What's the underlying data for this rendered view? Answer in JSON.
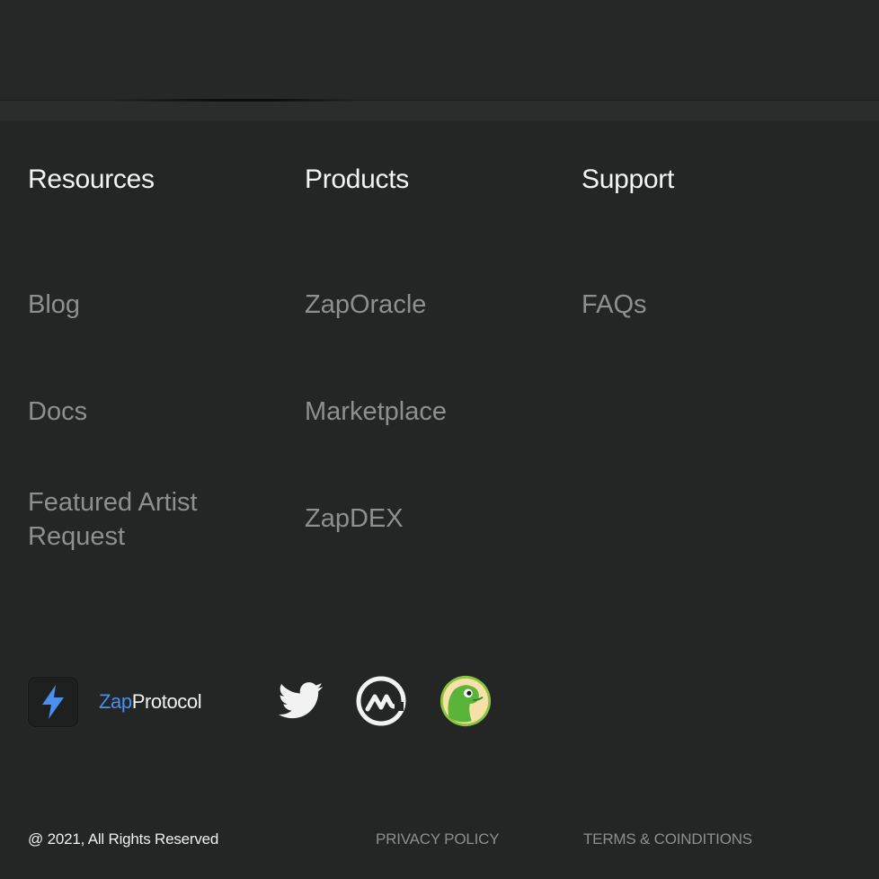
{
  "footer": {
    "columns": [
      {
        "title": "Resources",
        "links": [
          "Blog",
          "Docs",
          "Featured Artist Request"
        ]
      },
      {
        "title": "Products",
        "links": [
          "ZapOracle",
          "Marketplace",
          "ZapDEX"
        ]
      },
      {
        "title": "Support",
        "links": [
          "FAQs"
        ]
      }
    ],
    "brand": {
      "name_accent": "Zap",
      "name_rest": "Protocol",
      "icon": "lightning-bolt-icon",
      "accent_color": "#4a8ff0"
    },
    "social": [
      {
        "name": "Twitter",
        "icon": "twitter-icon"
      },
      {
        "name": "CoinMarketCap",
        "icon": "coinmarketcap-icon"
      },
      {
        "name": "CoinGecko",
        "icon": "coingecko-icon"
      }
    ],
    "copyright": "@ 2021, All Rights Reserved",
    "legal": {
      "privacy": "PRIVACY POLICY",
      "terms": "TERMS & COINDITIONS"
    },
    "colors": {
      "background": "#242525",
      "heading": "#f3f3f3",
      "link": "#8f8f8f",
      "gecko_green": "#8bc53f"
    }
  }
}
